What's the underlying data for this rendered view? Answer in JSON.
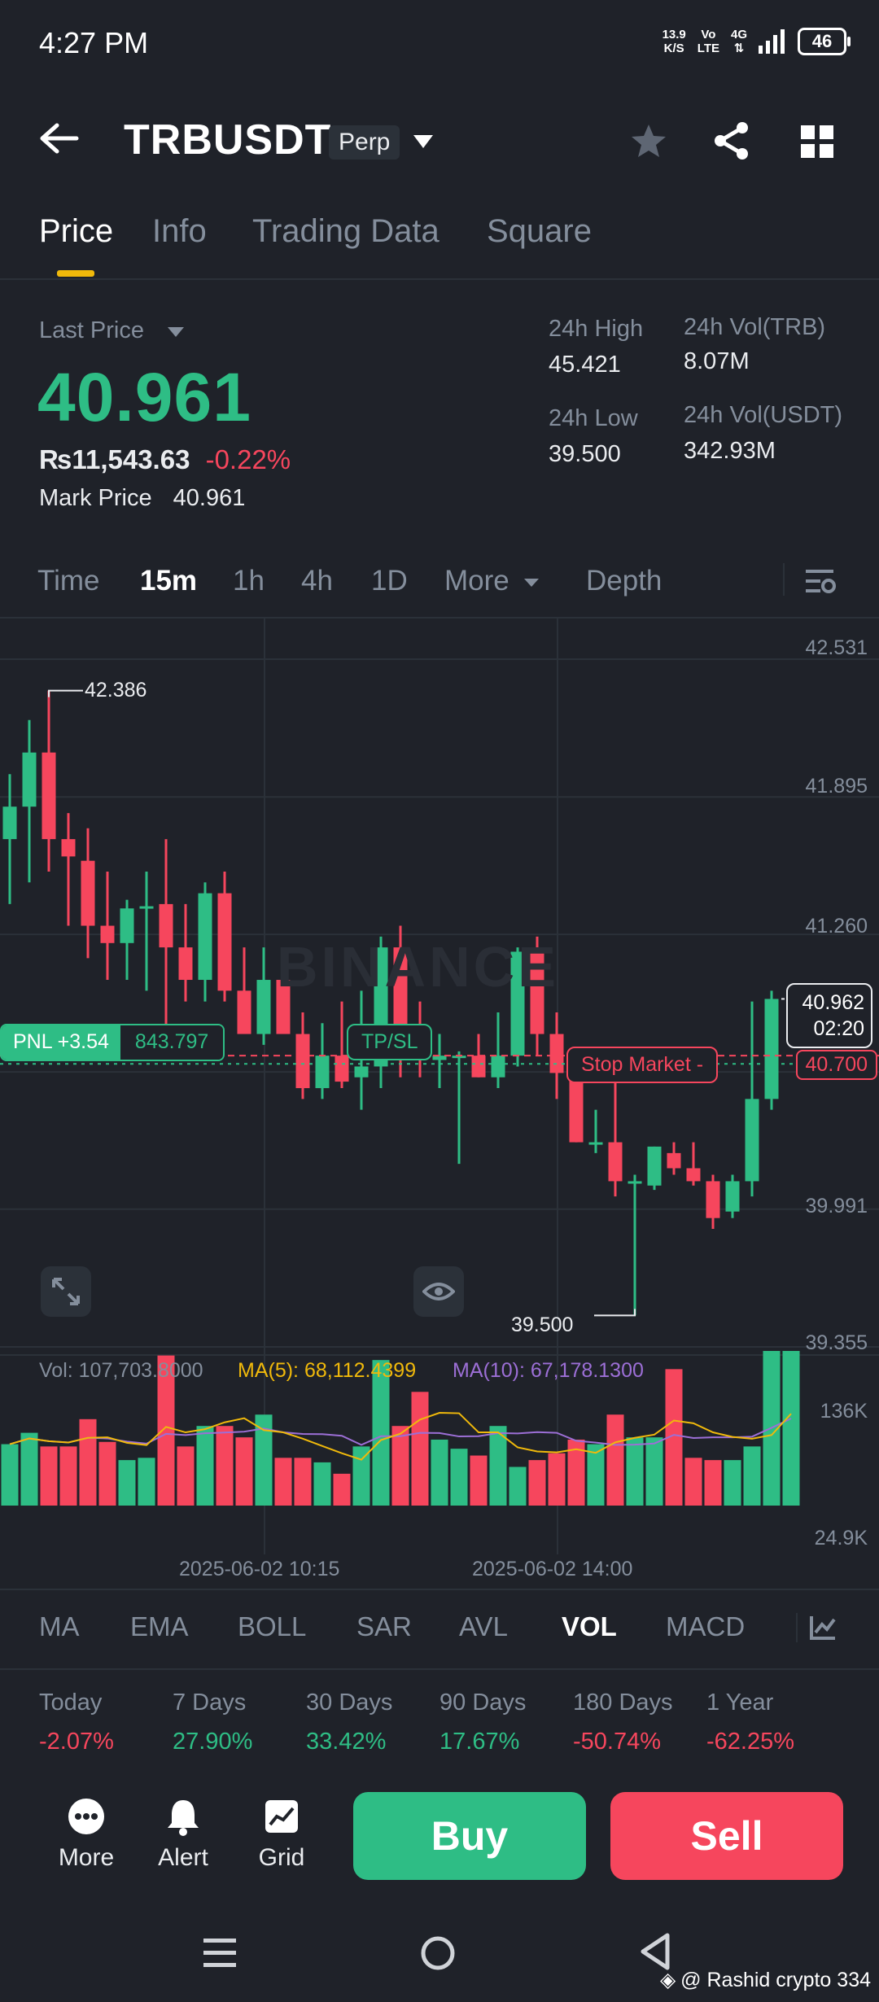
{
  "status_bar": {
    "time": "4:27 PM",
    "net_speed": "13.9",
    "net_unit": "K/S",
    "volte_top": "Vo",
    "volte_bottom": "LTE",
    "network": "4G",
    "battery": "46"
  },
  "header": {
    "symbol": "TRBUSDT",
    "badge": "Perp"
  },
  "tabs": [
    "Price",
    "Info",
    "Trading Data",
    "Square"
  ],
  "price_panel": {
    "last_price_label": "Last Price",
    "last_price": "40.961",
    "fiat_price": "₨11,543.63",
    "change_pct": "-0.22%",
    "mark_price_label": "Mark Price",
    "mark_price": "40.961",
    "high_label": "24h High",
    "high": "45.421",
    "low_label": "24h Low",
    "low": "39.500",
    "vol_base_label": "24h Vol(TRB)",
    "vol_base": "8.07M",
    "vol_quote_label": "24h Vol(USDT)",
    "vol_quote": "342.93M"
  },
  "intervals": {
    "time": "Time",
    "m15": "15m",
    "h1": "1h",
    "h4": "4h",
    "d1": "1D",
    "more": "More",
    "depth": "Depth"
  },
  "chart": {
    "price_axis": [
      "42.531",
      "41.895",
      "41.260",
      "40.700",
      "39.991",
      "39.355"
    ],
    "high_marker": "42.386",
    "low_marker": "39.500",
    "last_price_tag": "40.962",
    "countdown": "02:20",
    "pnl_label": "PNL +3.54",
    "entry_price": "843.797",
    "tpsl_label": "TP/SL",
    "stop_label": "Stop Market  -",
    "stop_price": "40.700",
    "watermark": "BINANCE",
    "vol_axis_top": "136K",
    "vol_axis_bottom": "24.9K",
    "dates": [
      "2025-06-02 10:15",
      "2025-06-02 14:00"
    ],
    "vol_text": "Vol: 107,703.8000",
    "ma5_text": "MA(5): 68,112.4399",
    "ma10_text": "MA(10): 67,178.1300",
    "up_color": "#2ebd85",
    "down_color": "#f6465d"
  },
  "chart_data": {
    "type": "candlestick",
    "interval": "15m",
    "ylim": [
      39.355,
      42.531
    ],
    "candles": [
      {
        "o": 41.7,
        "h": 42.0,
        "l": 41.4,
        "c": 41.85
      },
      {
        "o": 41.85,
        "h": 42.25,
        "l": 41.5,
        "c": 42.1
      },
      {
        "o": 42.1,
        "h": 42.386,
        "l": 41.55,
        "c": 41.7
      },
      {
        "o": 41.7,
        "h": 41.82,
        "l": 41.3,
        "c": 41.62
      },
      {
        "o": 41.6,
        "h": 41.75,
        "l": 41.15,
        "c": 41.3
      },
      {
        "o": 41.3,
        "h": 41.55,
        "l": 41.05,
        "c": 41.22
      },
      {
        "o": 41.22,
        "h": 41.42,
        "l": 41.05,
        "c": 41.38
      },
      {
        "o": 41.38,
        "h": 41.55,
        "l": 41.0,
        "c": 41.39
      },
      {
        "o": 41.4,
        "h": 41.7,
        "l": 40.7,
        "c": 41.2
      },
      {
        "o": 41.2,
        "h": 41.4,
        "l": 40.95,
        "c": 41.05
      },
      {
        "o": 41.05,
        "h": 41.5,
        "l": 40.95,
        "c": 41.45
      },
      {
        "o": 41.45,
        "h": 41.55,
        "l": 40.95,
        "c": 41.0
      },
      {
        "o": 41.0,
        "h": 41.2,
        "l": 40.8,
        "c": 40.8
      },
      {
        "o": 40.8,
        "h": 41.2,
        "l": 40.75,
        "c": 41.05
      },
      {
        "o": 41.05,
        "h": 41.15,
        "l": 40.8,
        "c": 40.8
      },
      {
        "o": 40.8,
        "h": 40.9,
        "l": 40.5,
        "c": 40.55
      },
      {
        "o": 40.55,
        "h": 40.85,
        "l": 40.5,
        "c": 40.7
      },
      {
        "o": 40.7,
        "h": 40.95,
        "l": 40.55,
        "c": 40.58
      },
      {
        "o": 40.6,
        "h": 41.0,
        "l": 40.45,
        "c": 40.65
      },
      {
        "o": 40.65,
        "h": 41.25,
        "l": 40.55,
        "c": 41.2
      },
      {
        "o": 41.2,
        "h": 41.3,
        "l": 40.6,
        "c": 40.75
      },
      {
        "o": 40.75,
        "h": 40.95,
        "l": 40.6,
        "c": 40.68
      },
      {
        "o": 40.68,
        "h": 40.8,
        "l": 40.55,
        "c": 40.7
      },
      {
        "o": 40.7,
        "h": 40.72,
        "l": 40.2,
        "c": 40.7
      },
      {
        "o": 40.7,
        "h": 40.8,
        "l": 40.6,
        "c": 40.6
      },
      {
        "o": 40.6,
        "h": 40.9,
        "l": 40.55,
        "c": 40.7
      },
      {
        "o": 40.7,
        "h": 41.2,
        "l": 40.65,
        "c": 41.18
      },
      {
        "o": 41.18,
        "h": 41.25,
        "l": 40.7,
        "c": 40.8
      },
      {
        "o": 40.8,
        "h": 40.9,
        "l": 40.5,
        "c": 40.62
      },
      {
        "o": 40.62,
        "h": 40.7,
        "l": 40.3,
        "c": 40.3
      },
      {
        "o": 40.3,
        "h": 40.45,
        "l": 40.25,
        "c": 40.3
      },
      {
        "o": 40.3,
        "h": 40.6,
        "l": 40.05,
        "c": 40.12
      },
      {
        "o": 40.12,
        "h": 40.15,
        "l": 39.5,
        "c": 40.12
      },
      {
        "o": 40.1,
        "h": 40.28,
        "l": 40.08,
        "c": 40.28
      },
      {
        "o": 40.25,
        "h": 40.3,
        "l": 40.15,
        "c": 40.18
      },
      {
        "o": 40.18,
        "h": 40.3,
        "l": 40.1,
        "c": 40.12
      },
      {
        "o": 40.12,
        "h": 40.15,
        "l": 39.9,
        "c": 39.95
      },
      {
        "o": 39.98,
        "h": 40.15,
        "l": 39.95,
        "c": 40.12
      },
      {
        "o": 40.12,
        "h": 40.95,
        "l": 40.05,
        "c": 40.5
      },
      {
        "o": 40.5,
        "h": 41.0,
        "l": 40.45,
        "c": 40.962
      }
    ],
    "volumes": [
      54,
      64,
      52,
      52,
      76,
      56,
      40,
      42,
      132,
      52,
      70,
      70,
      60,
      80,
      42,
      42,
      38,
      28,
      52,
      128,
      70,
      100,
      58,
      50,
      44,
      70,
      34,
      40,
      46,
      58,
      54,
      80,
      60,
      60,
      120,
      42,
      40,
      40,
      52,
      136,
      136
    ]
  },
  "indicators": [
    "MA",
    "EMA",
    "BOLL",
    "SAR",
    "AVL",
    "VOL",
    "MACD"
  ],
  "performance": [
    {
      "label": "Today",
      "value": "-2.07%"
    },
    {
      "label": "7 Days",
      "value": "27.90%"
    },
    {
      "label": "30 Days",
      "value": "33.42%"
    },
    {
      "label": "90 Days",
      "value": "17.67%"
    },
    {
      "label": "180 Days",
      "value": "-50.74%"
    },
    {
      "label": "1 Year",
      "value": "-62.25%"
    }
  ],
  "actions": {
    "more": "More",
    "alert": "Alert",
    "grid": "Grid",
    "buy": "Buy",
    "sell": "Sell"
  },
  "watermark_footer": "@ Rashid crypto 334"
}
